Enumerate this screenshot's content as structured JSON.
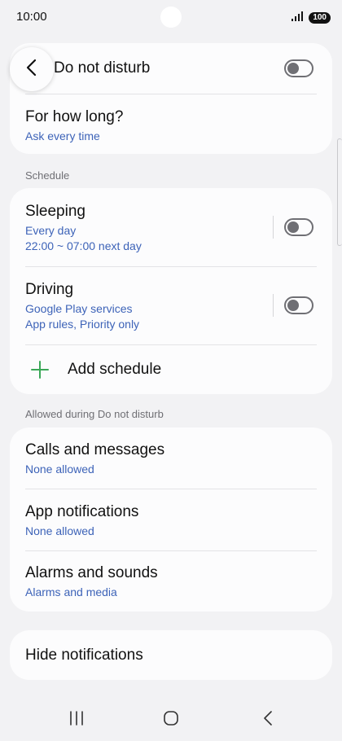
{
  "status_bar": {
    "time": "10:00",
    "battery": "100"
  },
  "header": {
    "title": "Do not disturb"
  },
  "top_card": {
    "duration_title": "For how long?",
    "duration_value": "Ask every time"
  },
  "schedule": {
    "section_label": "Schedule",
    "items": [
      {
        "title": "Sleeping",
        "line1": "Every day",
        "line2": "22:00 ~ 07:00 next day",
        "enabled": false
      },
      {
        "title": "Driving",
        "line1": "Google Play services",
        "line2": "App rules, Priority only",
        "enabled": false
      }
    ],
    "add_label": "Add schedule"
  },
  "allowed": {
    "section_label": "Allowed during Do not disturb",
    "items": [
      {
        "title": "Calls and messages",
        "value": "None allowed"
      },
      {
        "title": "App notifications",
        "value": "None allowed"
      },
      {
        "title": "Alarms and sounds",
        "value": "Alarms and media"
      }
    ]
  },
  "hide": {
    "title": "Hide notifications"
  },
  "colors": {
    "accent_text": "#3d63b8",
    "add_icon": "#3aa757",
    "background": "#f2f2f4",
    "card": "#fcfcfd"
  },
  "icons": [
    "back-arrow-icon",
    "signal-icon",
    "add-icon",
    "recent-apps-icon",
    "home-icon",
    "nav-back-icon"
  ]
}
